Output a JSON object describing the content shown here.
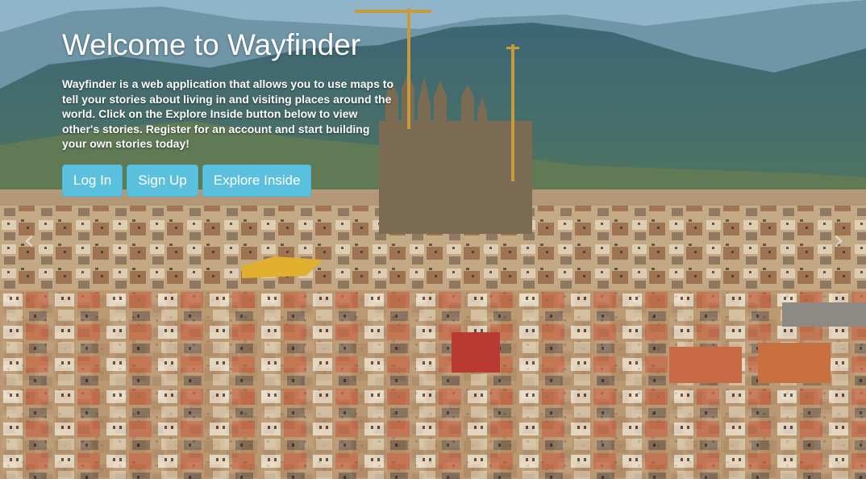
{
  "hero": {
    "title": "Welcome to Wayfinder",
    "description": "Wayfinder is a web application that allows you to use maps to tell your stories about living in and visiting places around the world. Click on the Explore Inside button below to view other's stories. Register for an account and start building your own stories today!",
    "buttons": {
      "login": "Log In",
      "signup": "Sign Up",
      "explore": "Explore Inside"
    },
    "button_color": "#5bc0de"
  },
  "carousel": {
    "prev_icon": "chevron-left-icon",
    "next_icon": "chevron-right-icon",
    "prev_glyph": "‹",
    "next_glyph": "›"
  }
}
